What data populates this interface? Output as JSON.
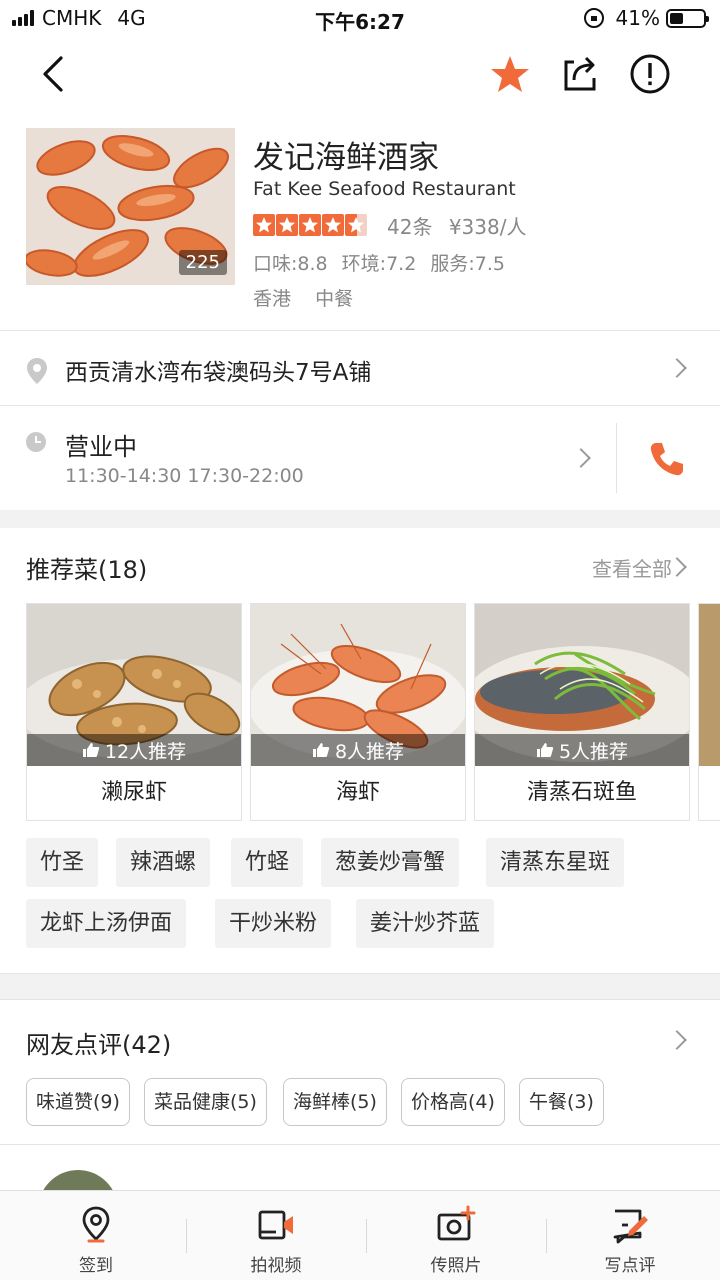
{
  "status_bar": {
    "carrier": "CMHK",
    "network": "4G",
    "time": "下午6:27",
    "battery": "41%"
  },
  "shop": {
    "name": "发记海鲜酒家",
    "name_en": "Fat Kee Seafood Restaurant",
    "photo_count": "225",
    "rating_stars": 4.5,
    "review_count": "42条",
    "price": "¥338/人",
    "scores": [
      "口味:8.8",
      "环境:7.2",
      "服务:7.5"
    ],
    "tags": [
      "香港",
      "中餐"
    ]
  },
  "address": "西贡清水湾布袋澳码头7号A铺",
  "hours": {
    "status": "营业中",
    "time": "11:30-14:30 17:30-22:00"
  },
  "recommended": {
    "title": "推荐菜(18)",
    "see_all": "查看全部",
    "dishes": [
      {
        "name": "濑尿虾",
        "rec": "12人推荐"
      },
      {
        "name": "海虾",
        "rec": "8人推荐"
      },
      {
        "name": "清蒸石斑鱼",
        "rec": "5人推荐"
      }
    ],
    "chips": [
      "竹圣",
      "辣酒螺",
      "竹蛏",
      "葱姜炒膏蟹",
      "清蒸东星斑",
      "龙虾上汤伊面",
      "干炒米粉",
      "姜汁炒芥蓝"
    ]
  },
  "reviews": {
    "title": "网友点评(42)",
    "tags": [
      "味道赞(9)",
      "菜品健康(5)",
      "海鲜棒(5)",
      "价格高(4)",
      "午餐(3)"
    ]
  },
  "tabbar": {
    "items": [
      "签到",
      "拍视频",
      "传照片",
      "写点评"
    ]
  },
  "colors": {
    "accent": "#f06a3a",
    "divider": "#e4e4e4",
    "section_gap": "#f2f2f2"
  }
}
